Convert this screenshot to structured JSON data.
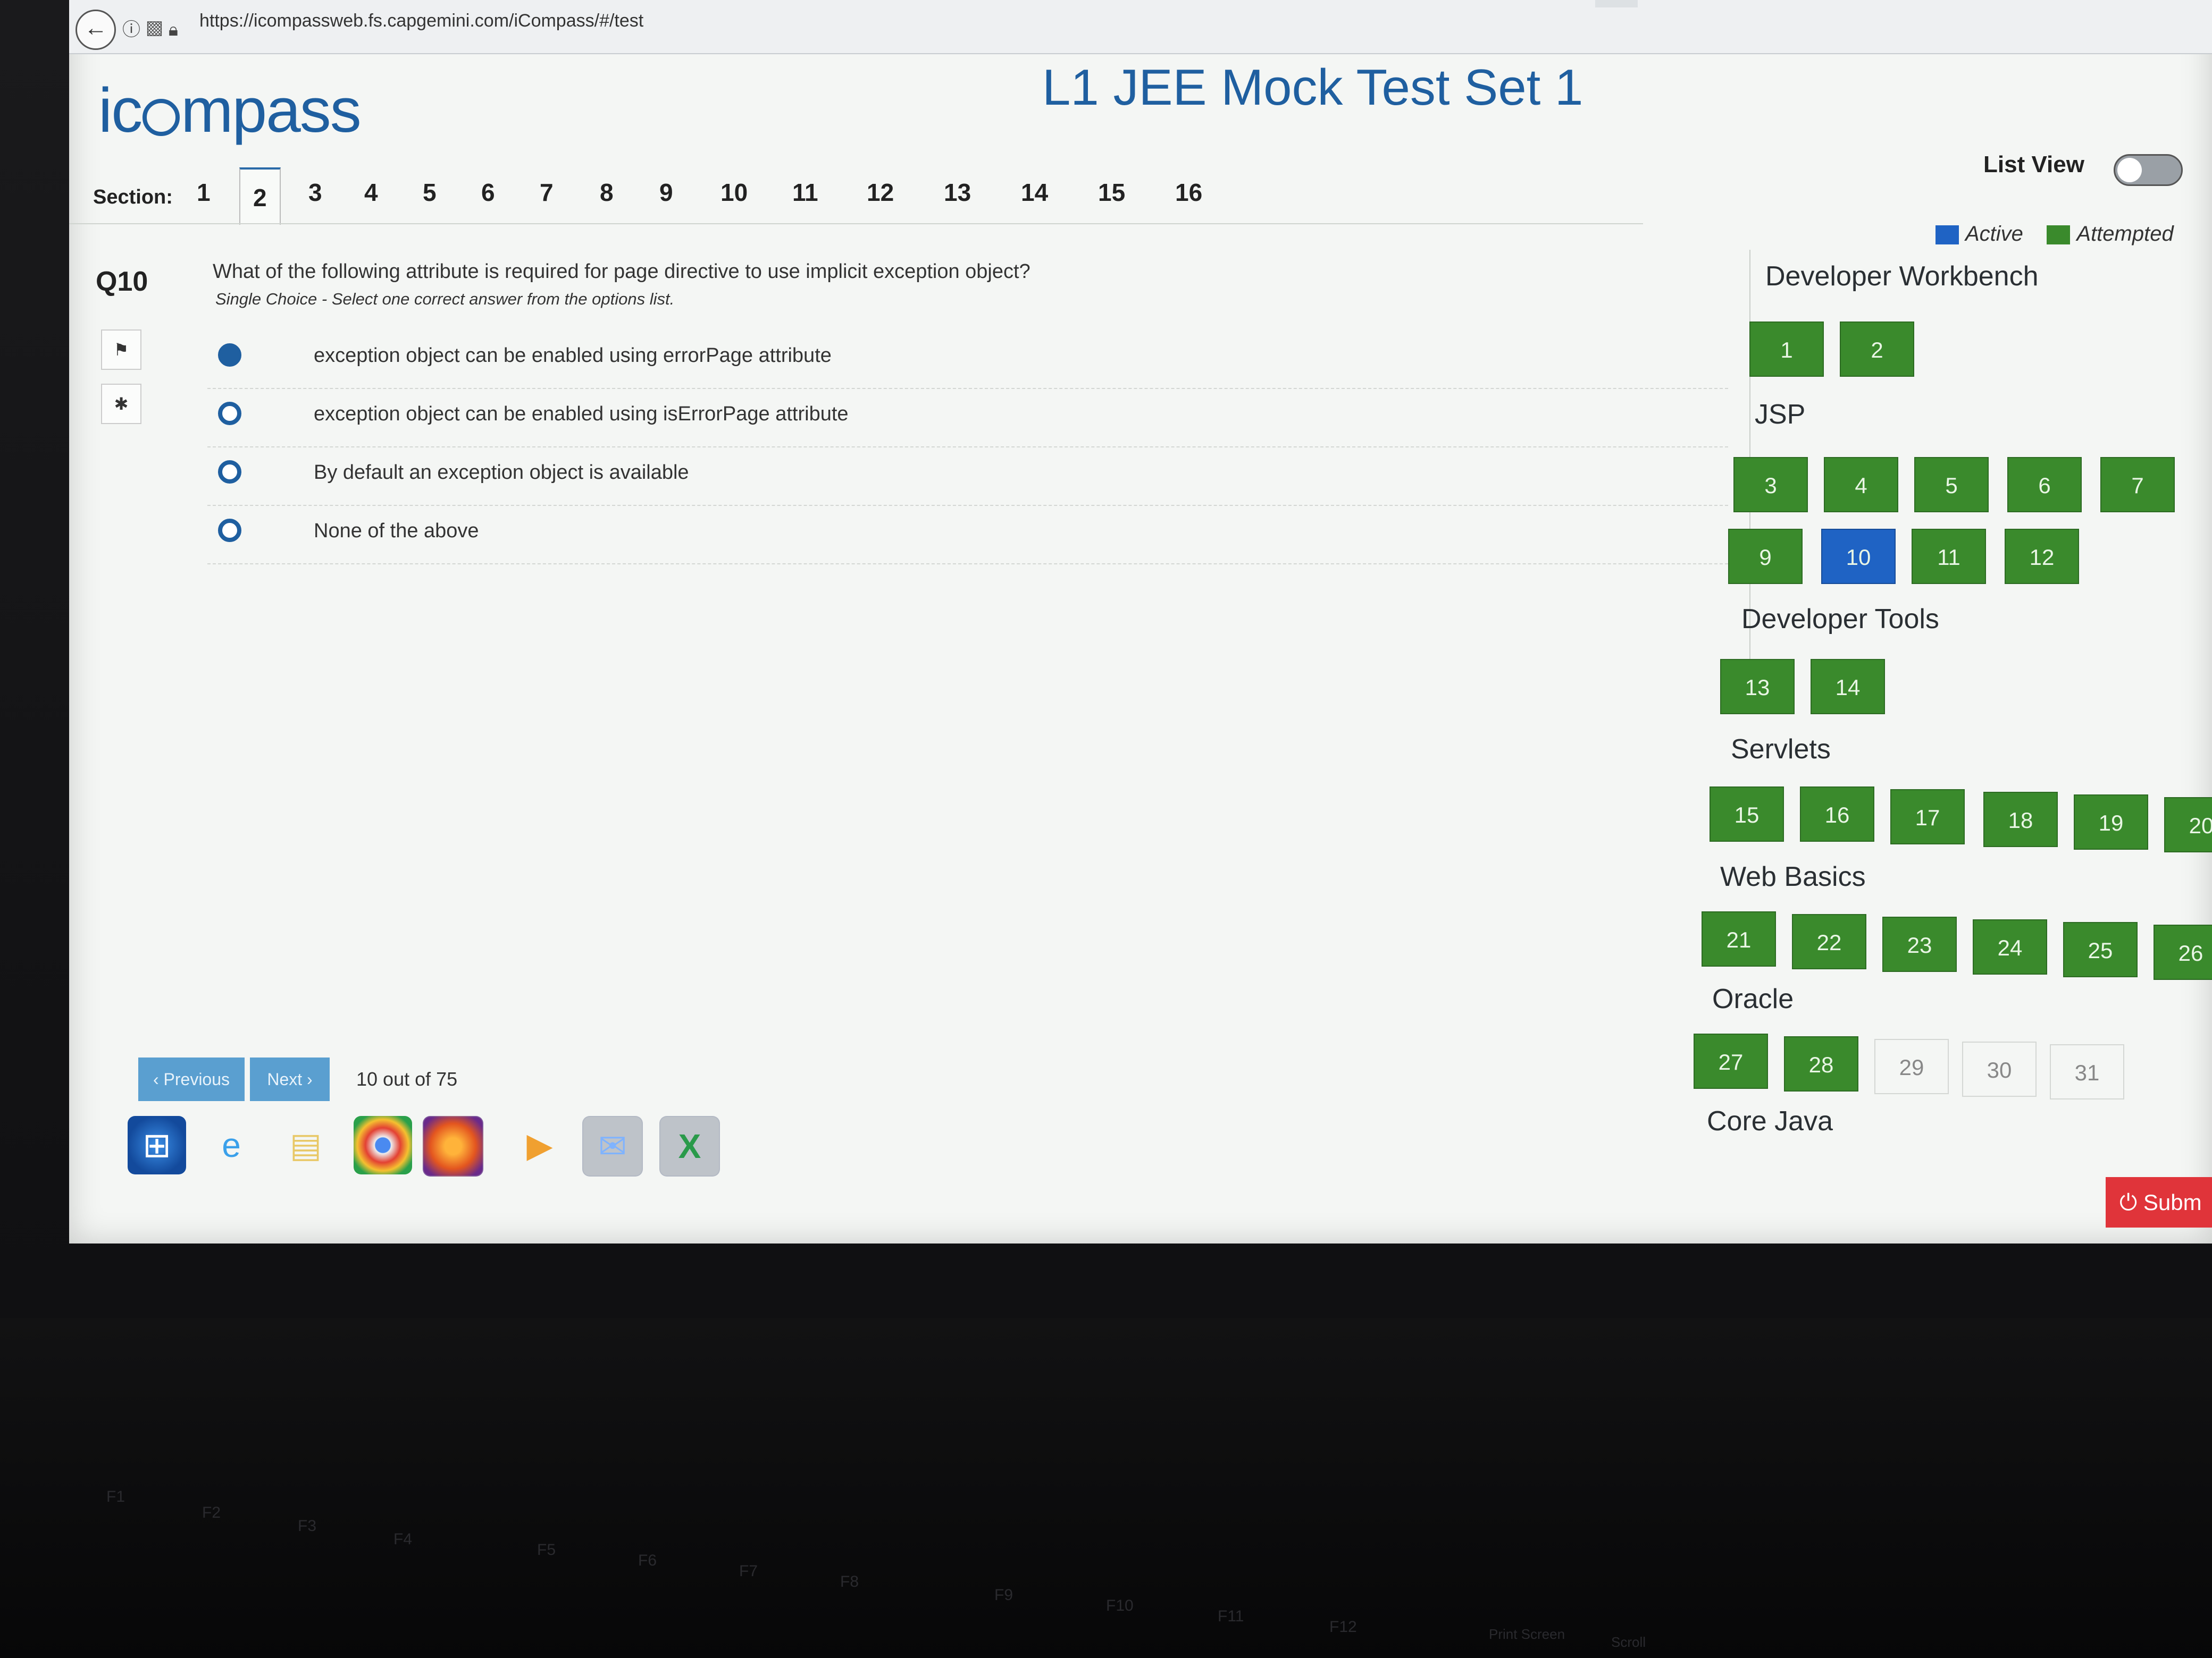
{
  "browser": {
    "url": "https://icompassweb.fs.capgemini.com/iCompass/#/test",
    "back_icon": "←"
  },
  "header": {
    "logo_text_1": "ic",
    "logo_text_2": "mpass",
    "title": "L1 JEE Mock Test Set 1",
    "list_view_label": "List View"
  },
  "sections": {
    "label": "Section:",
    "tabs": [
      "1",
      "2",
      "3",
      "4",
      "5",
      "6",
      "7",
      "8",
      "9",
      "10",
      "11",
      "12",
      "13",
      "14",
      "15",
      "16"
    ],
    "active": "2"
  },
  "legend": {
    "active_label": "Active",
    "attempted_label": "Attempted",
    "active_color": "#1f63c4",
    "attempted_color": "#3a8a2c"
  },
  "question": {
    "number": "Q10",
    "text": "What of the following attribute is required for page directive to use implicit exception object?",
    "type_hint": "Single Choice - Select one correct answer from the options list.",
    "options": [
      {
        "label": "exception object can be enabled using errorPage attribute",
        "selected": true
      },
      {
        "label": "exception object can be enabled using isErrorPage attribute",
        "selected": false
      },
      {
        "label": "By default an exception object is available",
        "selected": false
      },
      {
        "label": "None of the above",
        "selected": false
      }
    ],
    "tools": {
      "flag_icon": "⚑",
      "bug_icon": "✱"
    }
  },
  "nav": {
    "previous": "‹ Previous",
    "next": "Next ›",
    "progress": "10 out of 75"
  },
  "groups": {
    "developer_workbench": {
      "title": "Developer Workbench",
      "items": [
        "1",
        "2"
      ]
    },
    "jsp": {
      "title": "JSP",
      "items": [
        "3",
        "4",
        "5",
        "6",
        "7",
        "9",
        "10",
        "11",
        "12"
      ]
    },
    "developer_tools": {
      "title": "Developer Tools",
      "items": [
        "13",
        "14"
      ]
    },
    "servlets": {
      "title": "Servlets",
      "items": [
        "15",
        "16",
        "17",
        "18",
        "19",
        "20"
      ]
    },
    "web_basics": {
      "title": "Web Basics",
      "items": [
        "21",
        "22",
        "23",
        "24",
        "25",
        "26"
      ]
    },
    "oracle": {
      "title": "Oracle",
      "items": [
        "27",
        "28",
        "29",
        "30",
        "31"
      ]
    },
    "core_java": {
      "title": "Core Java"
    }
  },
  "submit": "⏻ Subm",
  "keyboard": [
    "F1",
    "F2",
    "F3",
    "F4",
    "F5",
    "F6",
    "F7",
    "F8",
    "F9",
    "F10",
    "F11",
    "F12",
    "Print Screen",
    "Scroll"
  ]
}
